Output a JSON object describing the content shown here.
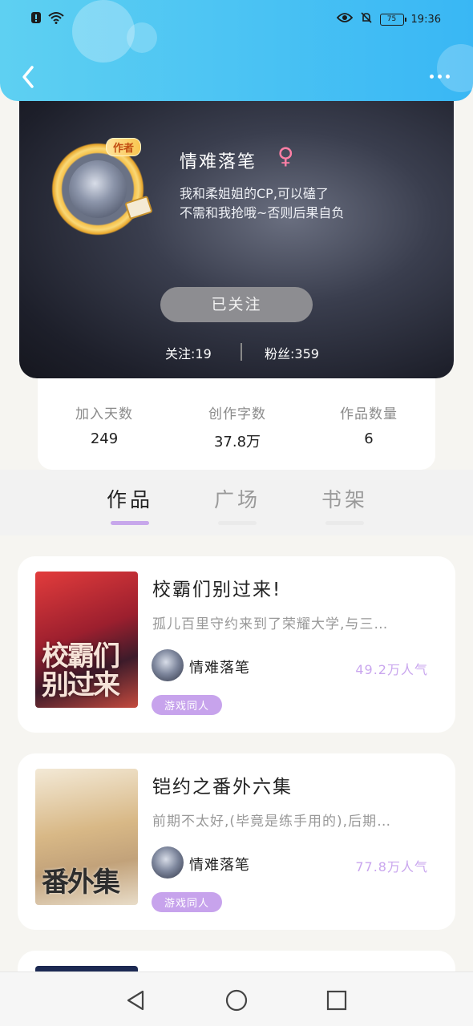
{
  "status_bar": {
    "time": "19:36",
    "battery": "75",
    "left_icons": [
      "alert-icon",
      "wifi-icon"
    ],
    "right_icons": [
      "eye-icon",
      "bell-mute-icon"
    ]
  },
  "header": {
    "back_icon": "chevron-left-icon",
    "more_icon": "more-dots-icon",
    "accent_color": "#39b7f4"
  },
  "profile": {
    "badge": "作者",
    "username": "情难落笔",
    "gender_symbol": "♀",
    "bio_line1": "我和柔姐姐的CP,可以磕了",
    "bio_line2": "不需和我抢哦~否则后果自负",
    "follow_button": "已关注",
    "following_text": "关注:19",
    "fans_text": "粉丝:359"
  },
  "stats": [
    {
      "label": "加入天数",
      "value": "249"
    },
    {
      "label": "创作字数",
      "value": "37.8万"
    },
    {
      "label": "作品数量",
      "value": "6"
    }
  ],
  "tabs": [
    {
      "label": "作品",
      "active": true
    },
    {
      "label": "广场",
      "active": false
    },
    {
      "label": "书架",
      "active": false
    }
  ],
  "works": [
    {
      "title": "校霸们别过来!",
      "description": "孤儿百里守约来到了荣耀大学,与三…",
      "author": "情难落笔",
      "popularity": "49.2万人气",
      "tag": "游戏同人",
      "cover_text": "校霸们别过来"
    },
    {
      "title": "铠约之番外六集",
      "description": "前期不太好,(毕竟是练手用的),后期…",
      "author": "情难落笔",
      "popularity": "77.8万人气",
      "tag": "游戏同人",
      "cover_text": "番外集"
    }
  ],
  "nav": {
    "back": "nav-back-icon",
    "home": "nav-home-icon",
    "recent": "nav-recent-icon"
  }
}
